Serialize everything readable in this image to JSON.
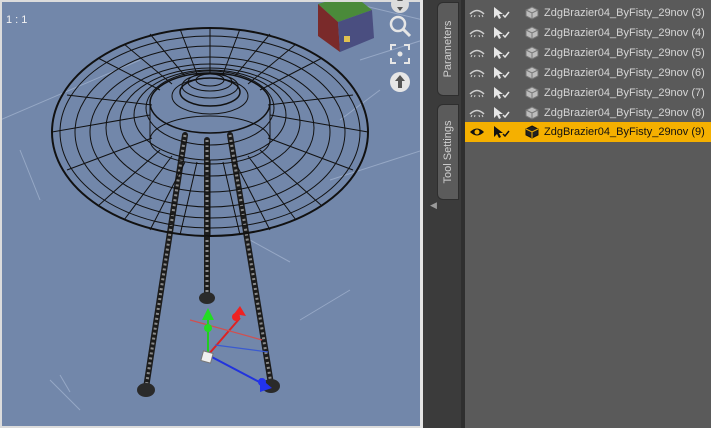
{
  "viewport": {
    "label": "1 : 1"
  },
  "tabs": [
    {
      "label": "Parameters"
    },
    {
      "label": "Tool Settings"
    }
  ],
  "scene": {
    "items": [
      {
        "name": "ZdgBrazier04_ByFisty_29nov (3)",
        "selected": false
      },
      {
        "name": "ZdgBrazier04_ByFisty_29nov (4)",
        "selected": false
      },
      {
        "name": "ZdgBrazier04_ByFisty_29nov (5)",
        "selected": false
      },
      {
        "name": "ZdgBrazier04_ByFisty_29nov (6)",
        "selected": false
      },
      {
        "name": "ZdgBrazier04_ByFisty_29nov (7)",
        "selected": false
      },
      {
        "name": "ZdgBrazier04_ByFisty_29nov (8)",
        "selected": false
      },
      {
        "name": "ZdgBrazier04_ByFisty_29nov (9)",
        "selected": true
      }
    ]
  },
  "icons": {
    "visibility": "eye-icon",
    "selectable": "cursor-arrow-icon",
    "node": "figure-node-icon",
    "navigation": [
      "view-cube-icon",
      "zoom-icon",
      "frame-icon",
      "orbit-icon"
    ]
  },
  "colors": {
    "viewport_bg": "#7287aa",
    "selection": "#f5b000",
    "panel_bg": "#5a5a5a"
  }
}
